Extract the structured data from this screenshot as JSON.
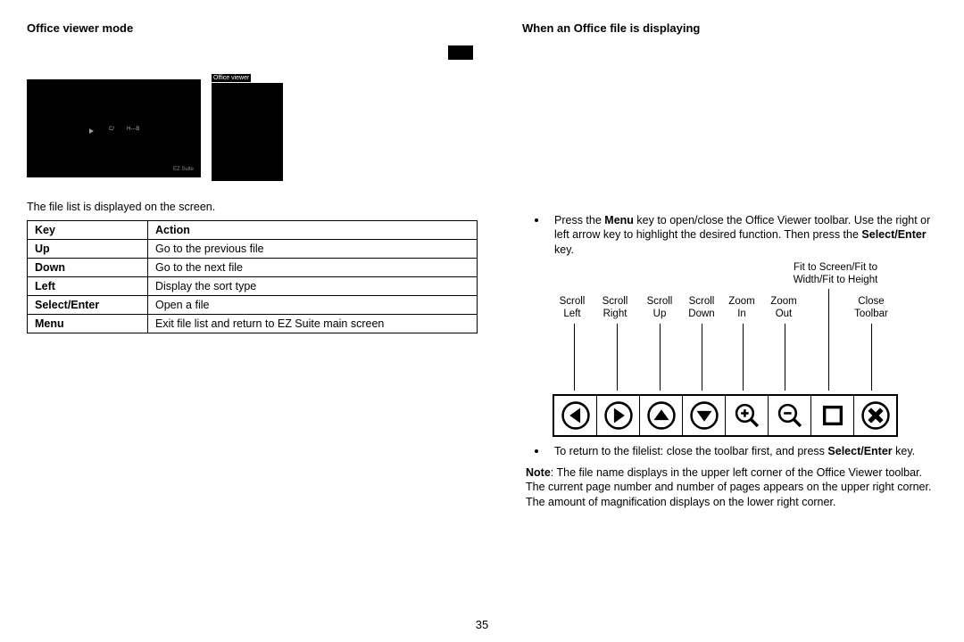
{
  "left": {
    "title": "Office viewer mode",
    "thumb2_label": "Office viewer",
    "caption": "The file list is displayed on the screen.",
    "table": {
      "head_key": "Key",
      "head_action": "Action",
      "rows": [
        {
          "key": "Up",
          "action": "Go to the previous file"
        },
        {
          "key": "Down",
          "action": "Go to the next file"
        },
        {
          "key": "Left",
          "action": "Display the sort type"
        },
        {
          "key": "Select/Enter",
          "action": "Open a file"
        },
        {
          "key": "Menu",
          "action": "Exit file list and return to EZ Suite main screen"
        }
      ]
    },
    "thumb1_suite": "EZ Suite"
  },
  "right": {
    "title": "When an Office file is displaying",
    "bullet1_pre": "Press the ",
    "bullet1_menu": "Menu",
    "bullet1_mid": " key to open/close the Office Viewer toolbar. Use the right or left arrow key to highlight the desired function. Then press the ",
    "bullet1_select": "Select/Enter",
    "bullet1_post": " key.",
    "toolbar_labels": {
      "scroll_left_1": "Scroll",
      "scroll_left_2": "Left",
      "scroll_right_1": "Scroll",
      "scroll_right_2": "Right",
      "scroll_up_1": "Scroll",
      "scroll_up_2": "Up",
      "scroll_down_1": "Scroll",
      "scroll_down_2": "Down",
      "zoom_in_1": "Zoom",
      "zoom_in_2": "In",
      "zoom_out_1": "Zoom",
      "zoom_out_2": "Out",
      "fit_1": "Fit to Screen/Fit to",
      "fit_2": "Width/Fit to Height",
      "close_1": "Close",
      "close_2": "Toolbar"
    },
    "bullet2_pre": "To return to the filelist: close the toolbar first, and press ",
    "bullet2_select": "Select/Enter",
    "bullet2_post": " key.",
    "note_label": "Note",
    "note_body": ": The file name displays in the upper left corner of the Office Viewer toolbar. The current page number and number of pages appears on the upper right corner. The amount of magnification displays on the lower right corner."
  },
  "page_number": "35"
}
